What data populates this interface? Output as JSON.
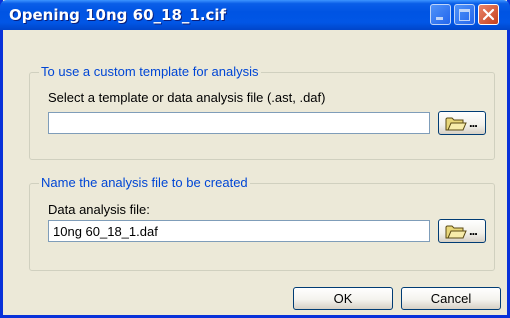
{
  "window": {
    "title": "Opening 10ng 60_18_1.cif"
  },
  "template_group": {
    "legend": "To use a custom template for analysis",
    "label": "Select a template or data analysis file (.ast, .daf)",
    "value": "",
    "browse_label": "..."
  },
  "analysis_group": {
    "legend": "Name the analysis file to be created",
    "label": "Data analysis file:",
    "value": "10ng 60_18_1.daf",
    "browse_label": "..."
  },
  "buttons": {
    "ok": "OK",
    "cancel": "Cancel"
  },
  "icons": {
    "browse": "folder-open-icon",
    "minimize": "minimize-icon",
    "maximize": "maximize-icon",
    "close": "close-icon"
  },
  "colors": {
    "titlebar": "#0054e3",
    "dialog_background": "#ece9d8",
    "group_legend": "#0046d5",
    "close_button": "#c5401c"
  }
}
